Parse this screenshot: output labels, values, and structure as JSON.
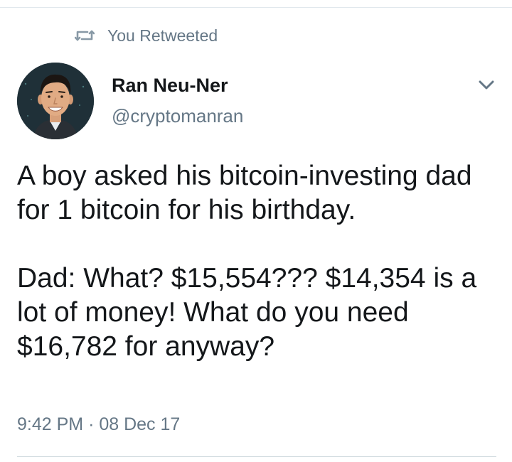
{
  "retweet": {
    "icon": "retweet-icon",
    "label": "You Retweeted"
  },
  "author": {
    "avatar": "avatar-photo",
    "name": "Ran Neu-Ner",
    "handle": "@cryptomanran"
  },
  "menu": {
    "icon": "chevron-down-icon"
  },
  "tweet": {
    "paragraph_1": "A boy asked his bitcoin-investing dad for 1 bitcoin for his birthday.",
    "paragraph_2": "Dad: What? $15,554??? $14,354 is a lot of money! What do you need $16,782 for anyway?"
  },
  "meta": {
    "time": "9:42 PM",
    "separator": "·",
    "date": "08 Dec 17"
  },
  "colors": {
    "primary_text": "#14171a",
    "secondary_text": "#657786",
    "divider": "#e1e8ed"
  }
}
